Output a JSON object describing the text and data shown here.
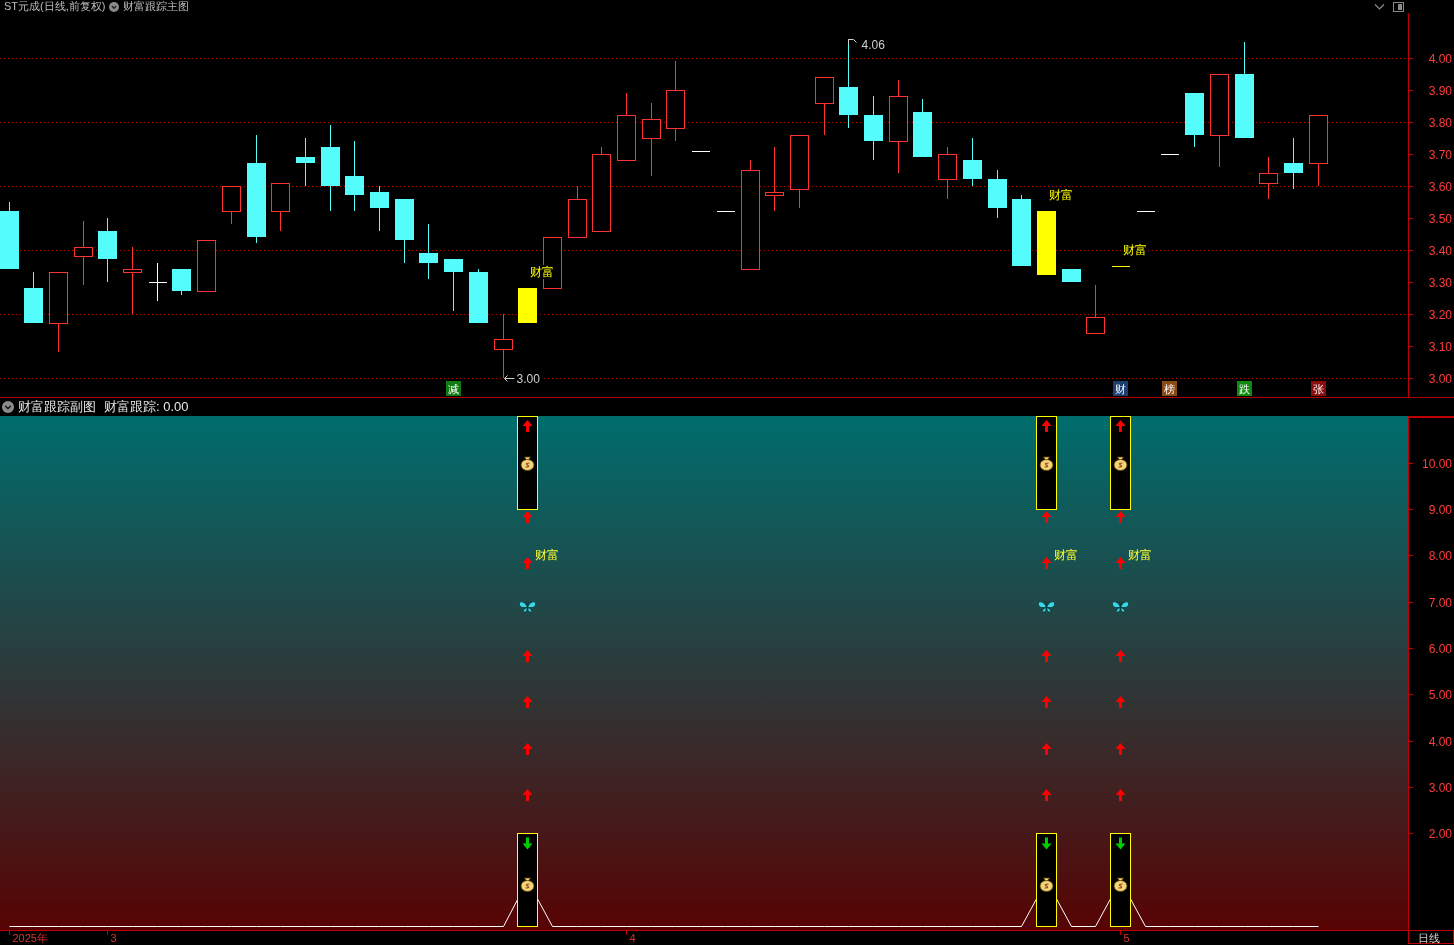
{
  "header": {
    "title": "ST元成(日线,前复权)",
    "indicator": "财富跟踪主图"
  },
  "main_chart": {
    "price_axis": [
      "4.00",
      "3.90",
      "3.80",
      "3.70",
      "3.60",
      "3.50",
      "3.40",
      "3.30",
      "3.20",
      "3.10",
      "3.00"
    ],
    "high_label": "4.06",
    "low_label": "3.00",
    "signals": [
      {
        "label": "财富"
      },
      {
        "label": "财富"
      },
      {
        "label": "财富"
      }
    ],
    "tiles": [
      {
        "label": "减",
        "color": "#127a12"
      },
      {
        "label": "财",
        "color": "#1d3f70"
      },
      {
        "label": "榜",
        "color": "#8a4a14"
      },
      {
        "label": "跌",
        "color": "#108a10"
      },
      {
        "label": "张",
        "color": "#8a0c0c"
      }
    ]
  },
  "sub_chart": {
    "title": "财富跟踪副图",
    "reading": "财富跟踪: 0.00",
    "value_axis": [
      "10.00",
      "9.00",
      "8.00",
      "7.00",
      "6.00",
      "5.00",
      "4.00",
      "3.00",
      "2.00"
    ],
    "signals": [
      {
        "label": "财富"
      },
      {
        "label": "财富"
      },
      {
        "label": "财富"
      }
    ],
    "date_axis": [
      "2025年",
      "3",
      "4",
      "5"
    ],
    "period": "日线"
  }
}
